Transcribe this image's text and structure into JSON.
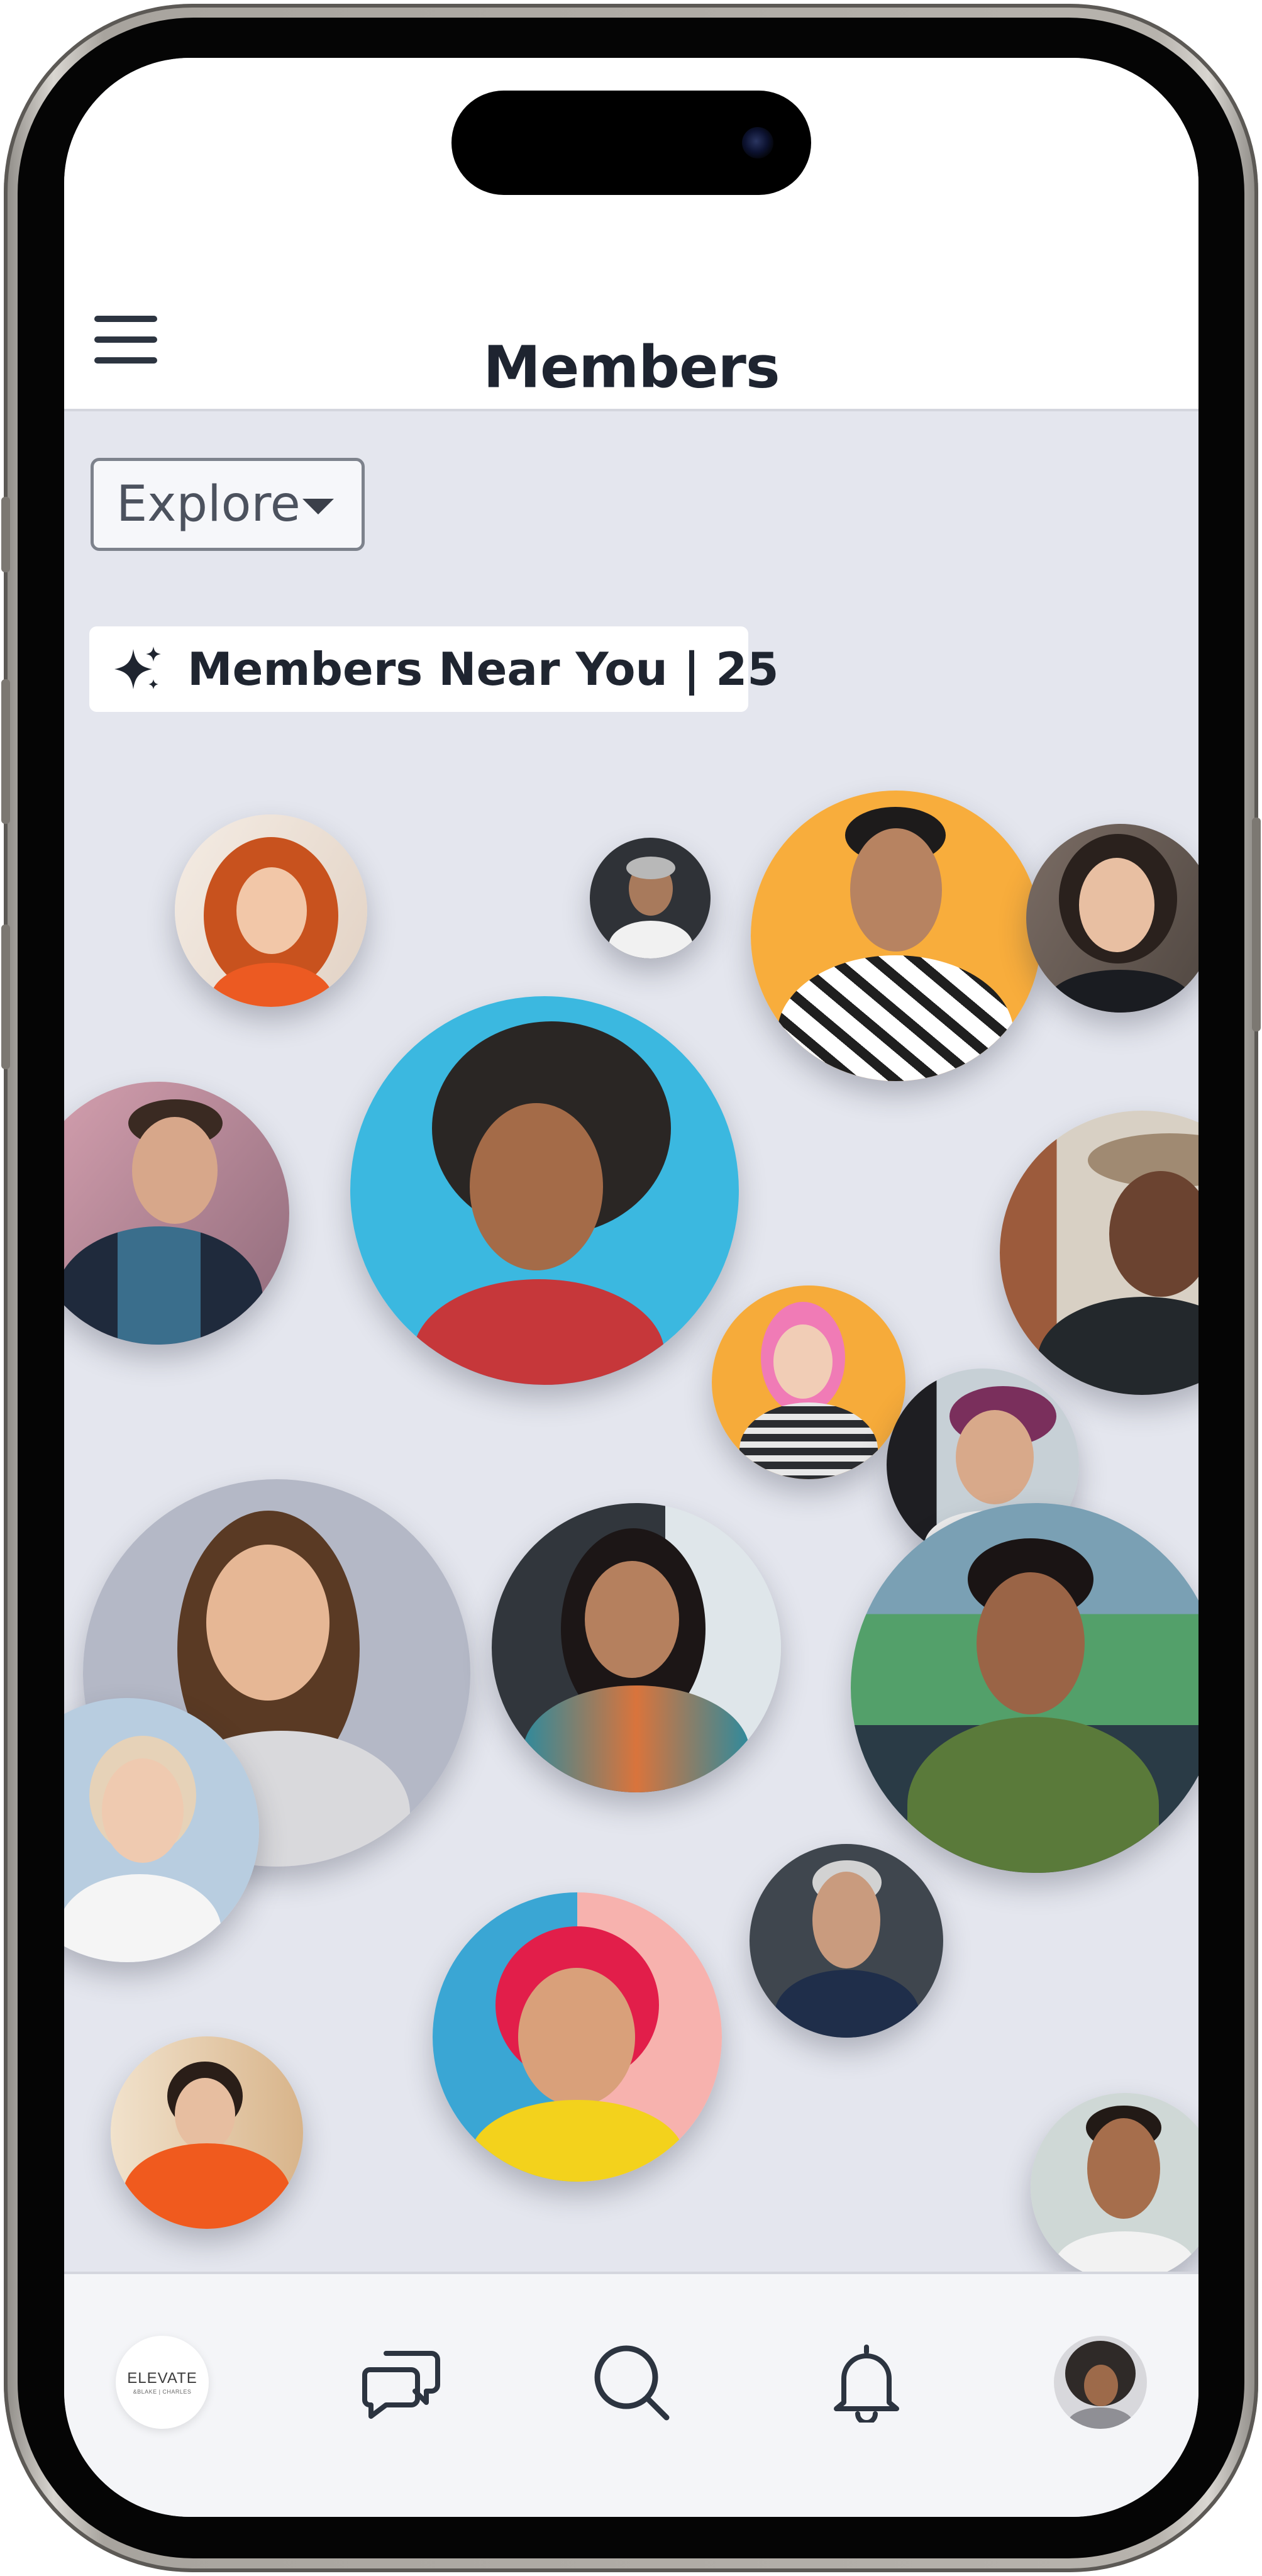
{
  "header": {
    "title": "Members",
    "menu_icon": "hamburger-menu-icon"
  },
  "filter": {
    "selected": "Explore",
    "caret_icon": "caret-down-icon"
  },
  "near_you": {
    "icon": "sparkle-icon",
    "label": "Members Near You | 25"
  },
  "colors": {
    "screen_bg": "#e4e6ee",
    "header_bg": "#ffffff",
    "title_text": "#1e2430",
    "tabbar_bg": "#f4f5f8",
    "icon_stroke": "#2c3440"
  },
  "member_avatars": [
    {
      "name": "member-avatar-red-curly-hair",
      "bg": "#f0e6dc"
    },
    {
      "name": "member-avatar-grey-beard-man",
      "bg": "#3a3d42"
    },
    {
      "name": "member-avatar-orange-bg-man",
      "bg": "#f8ad3c"
    },
    {
      "name": "member-avatar-dark-hair-woman",
      "bg": "#6b5f58"
    },
    {
      "name": "member-avatar-tattoo-man",
      "bg": "#b88a9a"
    },
    {
      "name": "member-avatar-afro-woman-blue",
      "bg": "#3bb8e0"
    },
    {
      "name": "member-avatar-hat-man",
      "bg": "#c9c2b8"
    },
    {
      "name": "member-avatar-pink-hair-woman",
      "bg": "#f6ab3a"
    },
    {
      "name": "member-avatar-purple-hair-man",
      "bg": "#b9c3cc"
    },
    {
      "name": "member-avatar-long-hair-woman",
      "bg": "#b4b8c6"
    },
    {
      "name": "member-avatar-curly-black-hair-woman",
      "bg": "#39414a"
    },
    {
      "name": "member-avatar-space-buns-woman",
      "bg": "#53a06a"
    },
    {
      "name": "member-avatar-blonde-woman",
      "bg": "#b8cde0"
    },
    {
      "name": "member-avatar-red-bob-woman",
      "bg": "#f7b2ae"
    },
    {
      "name": "member-avatar-white-beard-man",
      "bg": "#3f464e"
    },
    {
      "name": "member-avatar-orange-sweater-woman",
      "bg": "#e9cfae"
    },
    {
      "name": "member-avatar-smiling-beard-man",
      "bg": "#cfd8d6"
    }
  ],
  "tabbar": {
    "brand": {
      "name": "ELEVATE",
      "sub": "&BLAKE | CHARLES"
    },
    "messages_icon": "chat-bubbles-icon",
    "search_icon": "search-icon",
    "notifications_icon": "bell-icon",
    "profile_icon": "profile-avatar"
  }
}
